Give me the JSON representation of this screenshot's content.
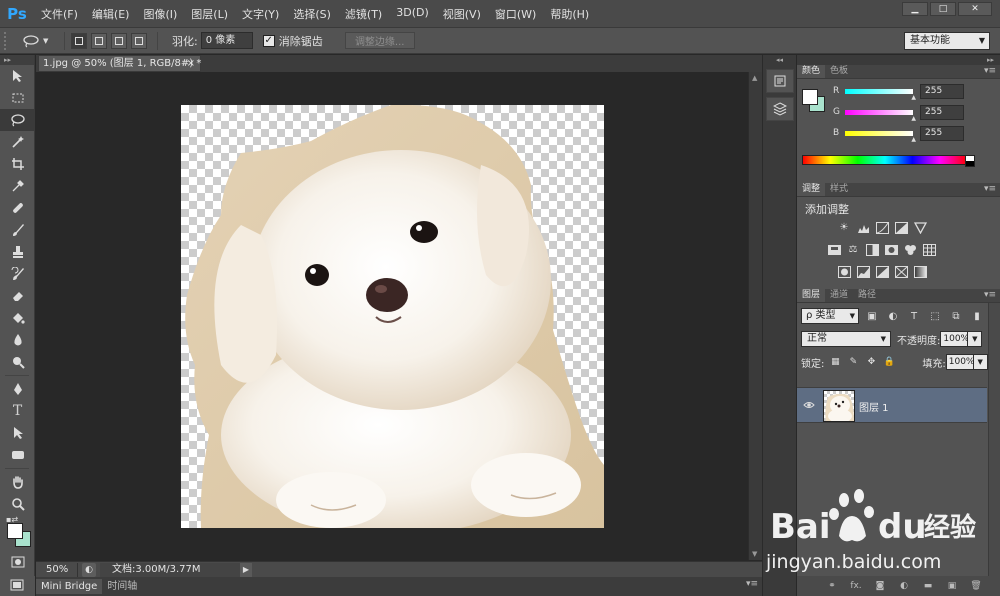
{
  "app": {
    "logo": "Ps",
    "menus": [
      "文件(F)",
      "编辑(E)",
      "图像(I)",
      "图层(L)",
      "文字(Y)",
      "选择(S)",
      "滤镜(T)",
      "3D(D)",
      "视图(V)",
      "窗口(W)",
      "帮助(H)"
    ],
    "window_controls": {
      "minimize": "▁",
      "maximize": "□",
      "close": "✕"
    }
  },
  "options_bar": {
    "feather_label": "羽化:",
    "feather_value": "0 像素",
    "antialias_label": "消除锯齿",
    "antialias_checked": "✓",
    "refine_edge_label": "调整边缘...",
    "workspace": "基本功能"
  },
  "document": {
    "tab_title": "1.jpg @ 50% (图层 1, RGB/8#) *",
    "close_glyph": "×",
    "zoom": "50%",
    "doc_info": "文档:3.00M/3.77M"
  },
  "bottom_tabs": [
    "Mini Bridge",
    "时间轴"
  ],
  "panels": {
    "color": {
      "tabs": [
        "颜色",
        "色板"
      ],
      "r_label": "R",
      "g_label": "G",
      "b_label": "B",
      "r": "255",
      "g": "255",
      "b": "255",
      "foreground": "#ffffff",
      "background": "#a9e2cd"
    },
    "adjustments": {
      "tabs": [
        "调整",
        "样式"
      ],
      "title": "添加调整"
    },
    "layers": {
      "tabs": [
        "图层",
        "通道",
        "路径"
      ],
      "kind": "ρ 类型",
      "blend_mode": "正常",
      "opacity_label": "不透明度:",
      "opacity": "100%",
      "lock_label": "锁定:",
      "fill_label": "填充:",
      "fill": "100%",
      "layer_name": "图层 1",
      "footer_icons": [
        "link-icon",
        "fx-icon",
        "mask-icon",
        "adjustment-icon",
        "group-icon",
        "new-layer-icon",
        "trash-icon"
      ],
      "footer_fx": "fx."
    }
  },
  "watermark": {
    "brand": "Bai",
    "brand_tail": "du",
    "product": "经验",
    "url": "jingyan.baidu.com"
  }
}
